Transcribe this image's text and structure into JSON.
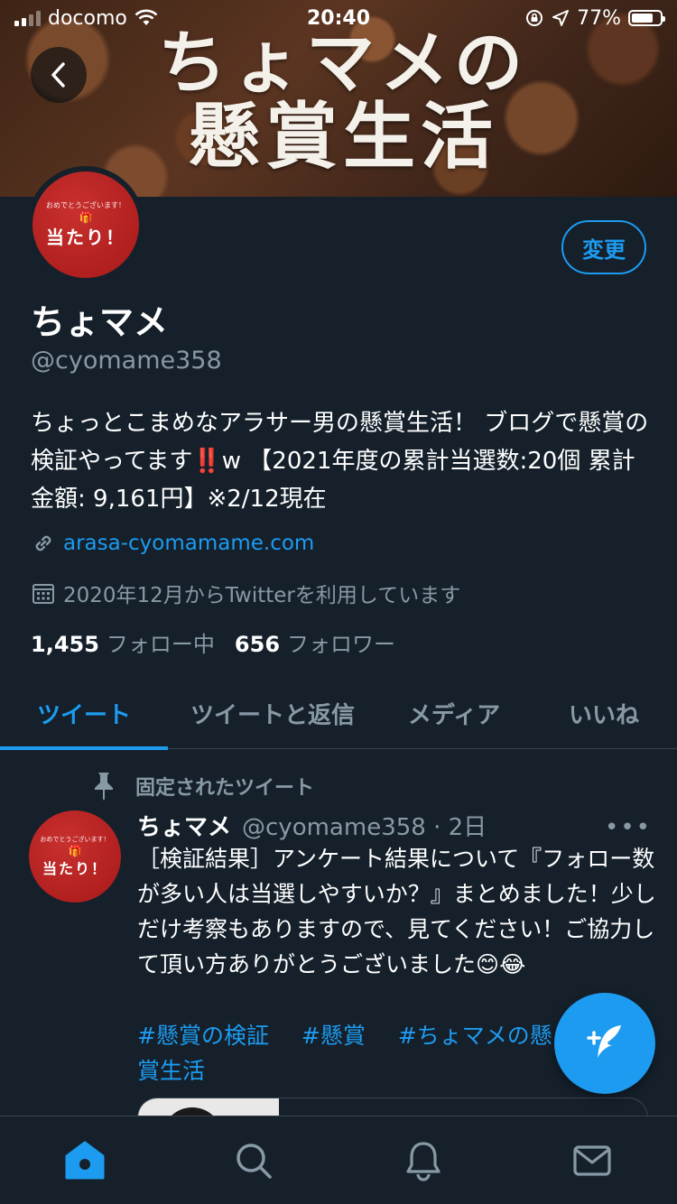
{
  "status_bar": {
    "carrier": "docomo",
    "time": "20:40",
    "battery": "77%",
    "battery_level": 0.77
  },
  "banner": {
    "title_line1": "ちょマメの",
    "title_line2": "懸賞生活"
  },
  "profile": {
    "avatar_small_text": "おめでとうございます！",
    "avatar_main_text": "当たり！",
    "edit_button": "変更",
    "display_name": "ちょマメ",
    "handle": "@cyomame358",
    "bio": "ちょっとこまめなアラサー男の懸賞生活！ ブログで懸賞の検証やってます‼️w 【2021年度の累計当選数:20個 累計金額: 9,161円】※2/12現在",
    "link": "arasa-cyomamame.com",
    "joined": "2020年12月からTwitterを利用しています",
    "following_count": "1,455",
    "following_label": "フォロー中",
    "followers_count": "656",
    "followers_label": "フォロワー"
  },
  "tabs": [
    {
      "label": "ツイート",
      "active": true
    },
    {
      "label": "ツイートと返信",
      "active": false
    },
    {
      "label": "メディア",
      "active": false
    },
    {
      "label": "いいね",
      "active": false
    }
  ],
  "tweet": {
    "pinned_label": "固定されたツイート",
    "name": "ちょマメ",
    "handle_time": "@cyomame358 · 2日",
    "more": "•••",
    "body": "［検証結果］アンケート結果について『フォロー数が多い人は当選しやすいか？』まとめました！少しだけ考察もありますので、見てください！ご協力して頂い方ありがとうございました😊😂",
    "hashtags": [
      "#懸賞の検証",
      "#懸賞",
      "#ちょマメの懸賞生活"
    ]
  },
  "colors": {
    "background": "#15202b",
    "accent": "#1d9bf0",
    "secondary_text": "#8899a6",
    "avatar_red": "#b1201f"
  },
  "icons": {
    "back": "chevron-left-icon",
    "link": "link-icon",
    "calendar": "calendar-icon",
    "pin": "pin-icon",
    "compose": "compose-feather-icon",
    "nav": [
      "home-icon",
      "search-icon",
      "bell-icon",
      "mail-icon"
    ]
  }
}
